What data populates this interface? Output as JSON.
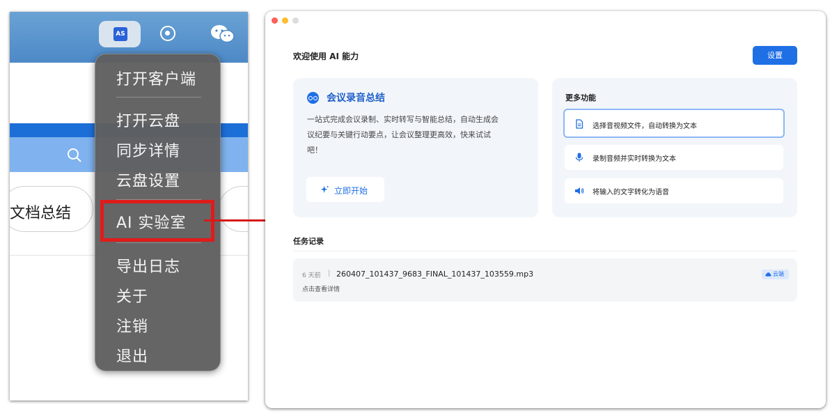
{
  "tray": {
    "app_icon_label": "AS",
    "icons": [
      "app-icon",
      "record-icon",
      "wechat-icon"
    ]
  },
  "background": {
    "doc_summary_label": "文档总结"
  },
  "context_menu": {
    "items": [
      {
        "label": "打开客户端"
      },
      {
        "label": "打开云盘"
      },
      {
        "label": "同步详情"
      },
      {
        "label": "云盘设置"
      },
      {
        "label": "AI 实验室"
      },
      {
        "label": "导出日志"
      },
      {
        "label": "关于"
      },
      {
        "label": "注销"
      },
      {
        "label": "退出"
      }
    ],
    "highlighted_item": "AI 实验室",
    "highlight_color": "#e01b1b"
  },
  "window": {
    "title": "欢迎使用 AI 能力",
    "settings_button": "设置",
    "meeting_card": {
      "title": "会议录音总结",
      "description": "一站式完成会议录制、实时转写与智能总结，自动生成会议纪要与关键行动要点，让会议整理更高效，快来试试吧！",
      "start_button": "立即开始"
    },
    "more_features": {
      "title": "更多功能",
      "items": [
        {
          "label": "选择音视频文件，自动转换为文本",
          "icon": "document-icon",
          "selected": true
        },
        {
          "label": "录制音频并实时转换为文本",
          "icon": "microphone-icon",
          "selected": false
        },
        {
          "label": "将输入的文字转化为语音",
          "icon": "speaker-icon",
          "selected": false
        }
      ]
    },
    "records": {
      "title": "任务记录",
      "items": [
        {
          "time": "6 天前",
          "separator": "|",
          "filename": "260407_101437_9683_FINAL_101437_103559.mp3",
          "detail": "点击查看详情",
          "badge": "云端"
        }
      ]
    }
  },
  "colors": {
    "accent": "#1f6fe5",
    "annotation_red": "#d71a1a"
  }
}
